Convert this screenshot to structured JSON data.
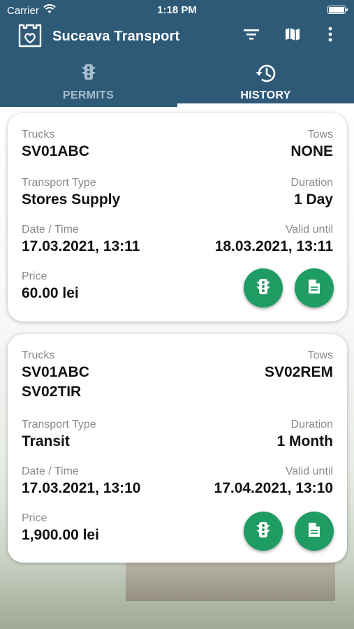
{
  "status_bar": {
    "carrier": "Carrier",
    "time": "1:18 PM"
  },
  "app_bar": {
    "title": "Suceava Transport",
    "actions": [
      "filter-icon",
      "map-icon",
      "more-vert-icon"
    ]
  },
  "tabs": [
    {
      "label": "PERMITS",
      "icon": "traffic-light-icon",
      "active": false
    },
    {
      "label": "HISTORY",
      "icon": "history-icon",
      "active": true
    }
  ],
  "labels": {
    "trucks": "Trucks",
    "tows": "Tows",
    "transport_type": "Transport Type",
    "duration": "Duration",
    "date_time": "Date / Time",
    "valid_until": "Valid until",
    "price": "Price"
  },
  "permits": [
    {
      "trucks": [
        "SV01ABC"
      ],
      "tows": "NONE",
      "transport_type": "Stores Supply",
      "duration": "1 Day",
      "date_time": "17.03.2021, 13:11",
      "valid_until": "18.03.2021, 13:11",
      "price": "60.00 lei"
    },
    {
      "trucks": [
        "SV01ABC",
        "SV02TIR"
      ],
      "tows": "SV02REM",
      "transport_type": "Transit",
      "duration": "1 Month",
      "date_time": "17.03.2021, 13:10",
      "valid_until": "17.04.2021, 13:10",
      "price": "1,900.00 lei"
    }
  ],
  "colors": {
    "header": "#2e5a78",
    "accent": "#1f9c63",
    "inactive_tab": "#a7bccb"
  }
}
